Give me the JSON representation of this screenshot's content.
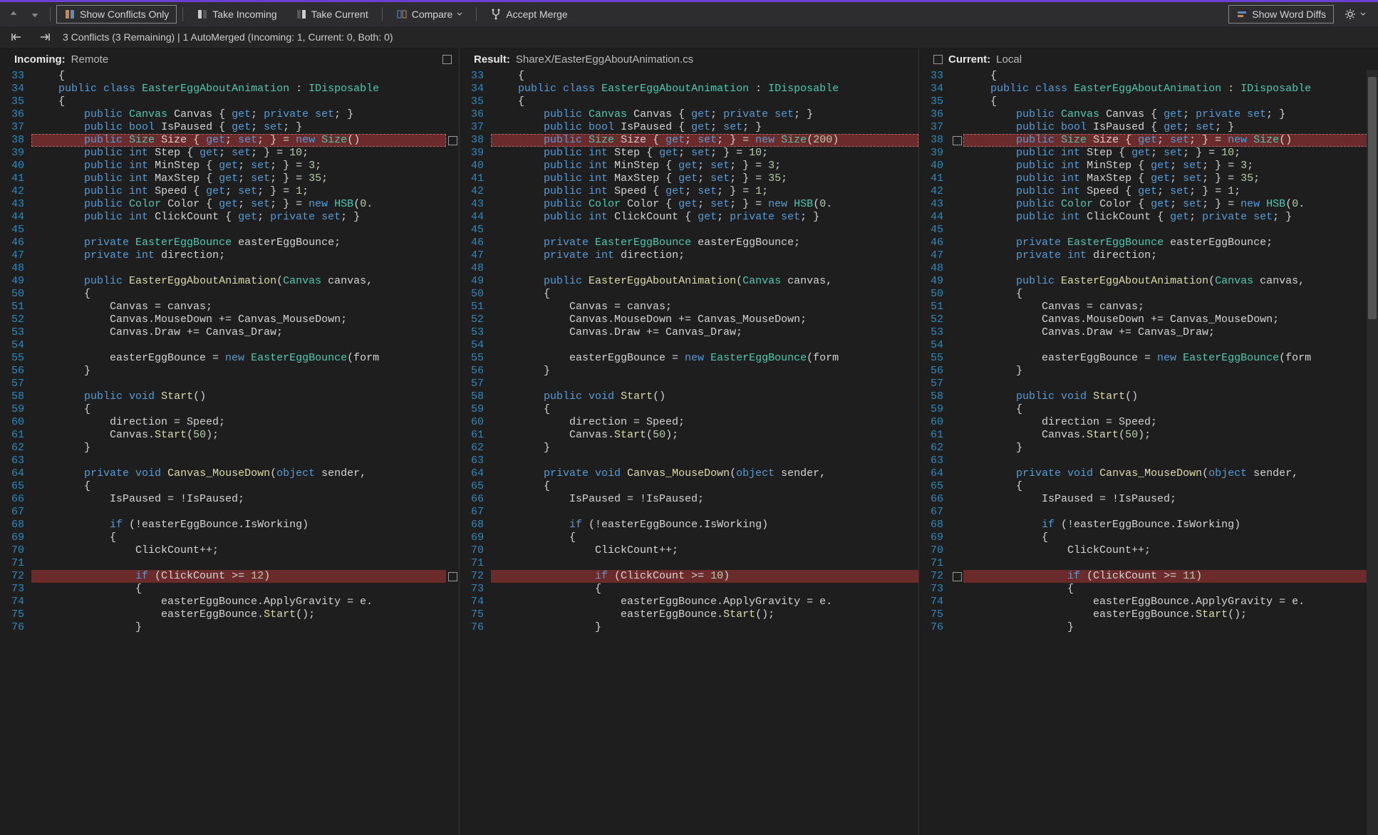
{
  "toolbar": {
    "show_conflicts": "Show Conflicts Only",
    "take_incoming": "Take Incoming",
    "take_current": "Take Current",
    "compare": "Compare",
    "accept_merge": "Accept Merge",
    "show_word_diffs": "Show Word Diffs"
  },
  "status": {
    "text": "3 Conflicts (3 Remaining) | 1 AutoMerged (Incoming: 1, Current: 0, Both: 0)"
  },
  "panes": {
    "incoming": {
      "title": "Incoming:",
      "sub": "Remote"
    },
    "result": {
      "title": "Result:",
      "sub": "ShareX/EasterEggAboutAnimation.cs"
    },
    "current": {
      "title": "Current:",
      "sub": "Local"
    }
  },
  "conflict_values": {
    "incoming_click": "12",
    "result_click": "10",
    "current_click": "11",
    "result_size": "200"
  },
  "code_lines": [
    {
      "n": 33,
      "t": "    {"
    },
    {
      "n": 34,
      "t": "    <kw>public</kw> <kw>class</kw> <type>EasterEggAboutAnimation</type> : <type>IDisposable</type>"
    },
    {
      "n": 35,
      "t": "    {"
    },
    {
      "n": 36,
      "t": "        <kw>public</kw> <type>Canvas</type> Canvas { <kw>get</kw>; <kw>private</kw> <kw>set</kw>; }"
    },
    {
      "n": 37,
      "t": "        <kw>public</kw> <kw>bool</kw> IsPaused { <kw>get</kw>; <kw>set</kw>; }"
    },
    {
      "n": 38,
      "t": "        <kw>public</kw> <type>Size</type> Size { <kw>get</kw>; <kw>set</kw>; } = <kw>new</kw> <type>Size</type>(<SIZE>)",
      "c1": true
    },
    {
      "n": 39,
      "t": "        <kw>public</kw> <kw>int</kw> Step { <kw>get</kw>; <kw>set</kw>; } = <num>10</num>;"
    },
    {
      "n": 40,
      "t": "        <kw>public</kw> <kw>int</kw> MinStep { <kw>get</kw>; <kw>set</kw>; } = <num>3</num>;"
    },
    {
      "n": 41,
      "t": "        <kw>public</kw> <kw>int</kw> MaxStep { <kw>get</kw>; <kw>set</kw>; } = <num>35</num>;"
    },
    {
      "n": 42,
      "t": "        <kw>public</kw> <kw>int</kw> Speed { <kw>get</kw>; <kw>set</kw>; } = <num>1</num>;"
    },
    {
      "n": 43,
      "t": "        <kw>public</kw> <type>Color</type> Color { <kw>get</kw>; <kw>set</kw>; } = <kw>new</kw> <type>HSB</type>(<num>0</num>."
    },
    {
      "n": 44,
      "t": "        <kw>public</kw> <kw>int</kw> ClickCount { <kw>get</kw>; <kw>private</kw> <kw>set</kw>; }"
    },
    {
      "n": 45,
      "t": ""
    },
    {
      "n": 46,
      "t": "        <kw>private</kw> <type>EasterEggBounce</type> easterEggBounce;"
    },
    {
      "n": 47,
      "t": "        <kw>private</kw> <kw>int</kw> direction;"
    },
    {
      "n": 48,
      "t": ""
    },
    {
      "n": 49,
      "t": "        <kw>public</kw> <method>EasterEggAboutAnimation</method>(<type>Canvas</type> canvas,"
    },
    {
      "n": 50,
      "t": "        {"
    },
    {
      "n": 51,
      "t": "            Canvas = canvas;"
    },
    {
      "n": 52,
      "t": "            Canvas.MouseDown += Canvas_MouseDown;"
    },
    {
      "n": 53,
      "t": "            Canvas.Draw += Canvas_Draw;"
    },
    {
      "n": 54,
      "t": ""
    },
    {
      "n": 55,
      "t": "            easterEggBounce = <kw>new</kw> <type>EasterEggBounce</type>(form"
    },
    {
      "n": 56,
      "t": "        }"
    },
    {
      "n": 57,
      "t": ""
    },
    {
      "n": 58,
      "t": "        <kw>public</kw> <kw>void</kw> <method>Start</method>()"
    },
    {
      "n": 59,
      "t": "        {"
    },
    {
      "n": 60,
      "t": "            direction = Speed;"
    },
    {
      "n": 61,
      "t": "            Canvas.<method>Start</method>(<num>50</num>);"
    },
    {
      "n": 62,
      "t": "        }"
    },
    {
      "n": 63,
      "t": ""
    },
    {
      "n": 64,
      "t": "        <kw>private</kw> <kw>void</kw> <method>Canvas_MouseDown</method>(<kw>object</kw> sender,"
    },
    {
      "n": 65,
      "t": "        {"
    },
    {
      "n": 66,
      "t": "            IsPaused = !IsPaused;"
    },
    {
      "n": 67,
      "t": ""
    },
    {
      "n": 68,
      "t": "            <kw>if</kw> (!easterEggBounce.IsWorking)"
    },
    {
      "n": 69,
      "t": "            {"
    },
    {
      "n": 70,
      "t": "                ClickCount++;"
    },
    {
      "n": 71,
      "t": ""
    },
    {
      "n": 72,
      "t": "                <kw>if</kw> (ClickCount >= <num><CLICK></num>)",
      "c2": true
    },
    {
      "n": 73,
      "t": "                {"
    },
    {
      "n": 74,
      "t": "                    easterEggBounce.ApplyGravity = e."
    },
    {
      "n": 75,
      "t": "                    easterEggBounce.<method>Start</method>();"
    },
    {
      "n": 76,
      "t": "                }"
    }
  ]
}
